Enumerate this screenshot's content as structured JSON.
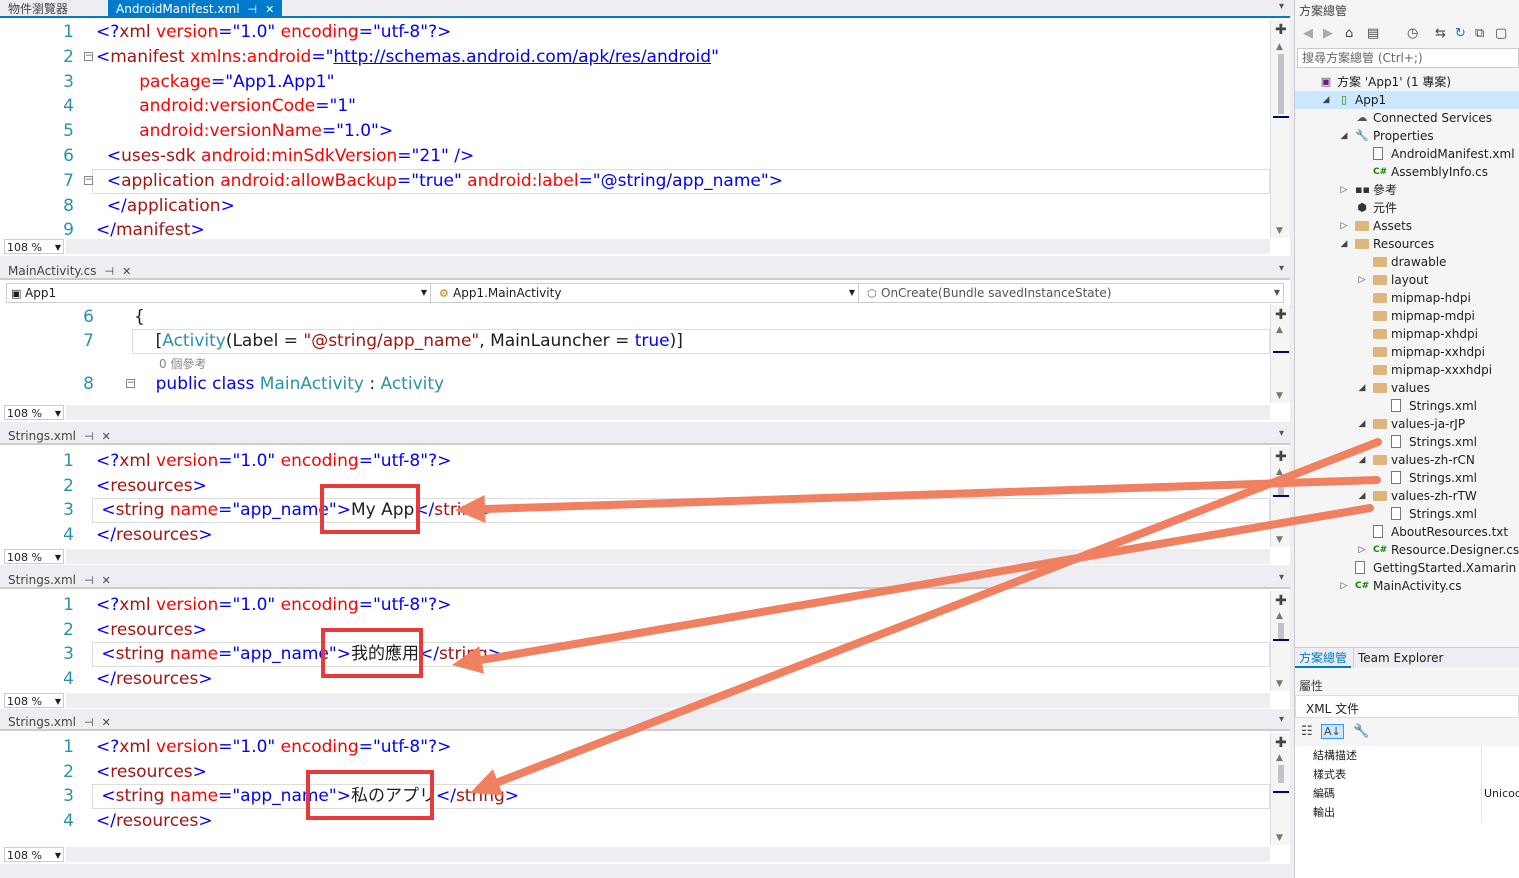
{
  "top_tabs": {
    "object_browser": "物件瀏覽器",
    "manifest": "AndroidManifest.xml"
  },
  "manifest_editor": {
    "zoom": "108 %",
    "lines": [
      {
        "n": "1",
        "parts": [
          [
            "b",
            "<?"
          ],
          [
            "r",
            "xml"
          ],
          [
            "rd",
            " version"
          ],
          [
            "b",
            "=\""
          ],
          [
            "b",
            "1.0"
          ],
          [
            "b",
            "\""
          ],
          [
            "rd",
            " encoding"
          ],
          [
            "b",
            "=\""
          ],
          [
            "b",
            "utf-8"
          ],
          [
            "b",
            "\"?>"
          ]
        ]
      },
      {
        "n": "2",
        "parts": [
          [
            "b",
            "<"
          ],
          [
            "r",
            "manifest"
          ],
          [
            "rd",
            " xmlns:android"
          ],
          [
            "b",
            "=\""
          ],
          [
            "u",
            "http://schemas.android.com/apk/res/android"
          ],
          [
            "b",
            "\""
          ]
        ]
      },
      {
        "n": "3",
        "parts": [
          [
            "",
            "        "
          ],
          [
            "rd",
            "package"
          ],
          [
            "b",
            "=\""
          ],
          [
            "b",
            "App1.App1"
          ],
          [
            "b",
            "\""
          ]
        ]
      },
      {
        "n": "4",
        "parts": [
          [
            "",
            "        "
          ],
          [
            "rd",
            "android:versionCode"
          ],
          [
            "b",
            "=\""
          ],
          [
            "b",
            "1"
          ],
          [
            "b",
            "\""
          ]
        ]
      },
      {
        "n": "5",
        "parts": [
          [
            "",
            "        "
          ],
          [
            "rd",
            "android:versionName"
          ],
          [
            "b",
            "=\""
          ],
          [
            "b",
            "1.0"
          ],
          [
            "b",
            "\">"
          ]
        ]
      },
      {
        "n": "6",
        "parts": [
          [
            "",
            "  "
          ],
          [
            "b",
            "<"
          ],
          [
            "r",
            "uses-sdk"
          ],
          [
            "rd",
            " android:minSdkVersion"
          ],
          [
            "b",
            "=\""
          ],
          [
            "b",
            "21"
          ],
          [
            "b",
            "\" />"
          ]
        ]
      },
      {
        "n": "7",
        "parts": [
          [
            "",
            "  "
          ],
          [
            "b",
            "<"
          ],
          [
            "r",
            "application"
          ],
          [
            "rd",
            " android:allowBackup"
          ],
          [
            "b",
            "=\""
          ],
          [
            "b",
            "true"
          ],
          [
            "b",
            "\""
          ],
          [
            "rd",
            " android:label"
          ],
          [
            "b",
            "=\""
          ],
          [
            "b",
            "@string/app_name"
          ],
          [
            "b",
            "\">"
          ]
        ]
      },
      {
        "n": "8",
        "parts": [
          [
            "",
            "  "
          ],
          [
            "b",
            "</"
          ],
          [
            "r",
            "application"
          ],
          [
            "b",
            ">"
          ]
        ]
      },
      {
        "n": "9",
        "parts": [
          [
            "b",
            "</"
          ],
          [
            "r",
            "manifest"
          ],
          [
            "b",
            ">"
          ]
        ]
      }
    ]
  },
  "mainactivity": {
    "tab": "MainActivity.cs",
    "nav": [
      "App1",
      "App1.MainActivity",
      "OnCreate(Bundle savedInstanceState)"
    ],
    "zoom": "108 %",
    "line6": "{",
    "line7_parts": [
      [
        "",
        "    ["
      ],
      [
        "t",
        "Activity"
      ],
      [
        "",
        "(Label = "
      ],
      [
        "r",
        "\"@string/app_name\""
      ],
      [
        "",
        ", MainLauncher = "
      ],
      [
        "k",
        "true"
      ],
      [
        "",
        ")]"
      ]
    ],
    "refs": "0 個參考",
    "line8_parts": [
      [
        "",
        "    "
      ],
      [
        "k",
        "public"
      ],
      [
        "k",
        " class"
      ],
      [
        "t",
        " MainActivity"
      ],
      [
        "",
        " : "
      ],
      [
        "t",
        "Activity"
      ]
    ],
    "ln6": "6",
    "ln7": "7",
    "ln8": "8"
  },
  "strings_editors": [
    {
      "tab": "Strings.xml",
      "zoom": "108 %",
      "value": "My App"
    },
    {
      "tab": "Strings.xml",
      "zoom": "108 %",
      "value": "我的應用"
    },
    {
      "tab": "Strings.xml",
      "zoom": "108 %",
      "value": "私のアプリ"
    }
  ],
  "solution_explorer": {
    "title": "方案總管",
    "search_placeholder": "搜尋方案總管 (Ctrl+;)",
    "items": [
      {
        "label": "方案 'App1' (1 專案)",
        "indent": 0,
        "icon": "solution-icon",
        "exp": ""
      },
      {
        "label": "App1",
        "indent": 1,
        "icon": "project-icon",
        "exp": "◢",
        "selected": true
      },
      {
        "label": "Connected Services",
        "indent": 2,
        "icon": "cloud-icon",
        "exp": ""
      },
      {
        "label": "Properties",
        "indent": 2,
        "icon": "wrench-icon",
        "exp": "◢"
      },
      {
        "label": "AndroidManifest.xml",
        "indent": 3,
        "icon": "file-icon",
        "exp": ""
      },
      {
        "label": "AssemblyInfo.cs",
        "indent": 3,
        "icon": "csharp-icon",
        "exp": ""
      },
      {
        "label": "參考",
        "indent": 2,
        "icon": "references-icon",
        "exp": "▷"
      },
      {
        "label": "元件",
        "indent": 2,
        "icon": "component-icon",
        "exp": ""
      },
      {
        "label": "Assets",
        "indent": 2,
        "icon": "folder-icon",
        "exp": "▷"
      },
      {
        "label": "Resources",
        "indent": 2,
        "icon": "folder-icon",
        "exp": "◢"
      },
      {
        "label": "drawable",
        "indent": 3,
        "icon": "folder-icon",
        "exp": ""
      },
      {
        "label": "layout",
        "indent": 3,
        "icon": "folder-icon",
        "exp": "▷"
      },
      {
        "label": "mipmap-hdpi",
        "indent": 3,
        "icon": "folder-icon",
        "exp": ""
      },
      {
        "label": "mipmap-mdpi",
        "indent": 3,
        "icon": "folder-icon",
        "exp": ""
      },
      {
        "label": "mipmap-xhdpi",
        "indent": 3,
        "icon": "folder-icon",
        "exp": ""
      },
      {
        "label": "mipmap-xxhdpi",
        "indent": 3,
        "icon": "folder-icon",
        "exp": ""
      },
      {
        "label": "mipmap-xxxhdpi",
        "indent": 3,
        "icon": "folder-icon",
        "exp": ""
      },
      {
        "label": "values",
        "indent": 3,
        "icon": "folder-icon",
        "exp": "◢"
      },
      {
        "label": "Strings.xml",
        "indent": 4,
        "icon": "file-icon",
        "exp": ""
      },
      {
        "label": "values-ja-rJP",
        "indent": 3,
        "icon": "folder-icon",
        "exp": "◢"
      },
      {
        "label": "Strings.xml",
        "indent": 4,
        "icon": "file-icon",
        "exp": ""
      },
      {
        "label": "values-zh-rCN",
        "indent": 3,
        "icon": "folder-icon",
        "exp": "◢"
      },
      {
        "label": "Strings.xml",
        "indent": 4,
        "icon": "file-icon",
        "exp": ""
      },
      {
        "label": "values-zh-rTW",
        "indent": 3,
        "icon": "folder-icon",
        "exp": "◢"
      },
      {
        "label": "Strings.xml",
        "indent": 4,
        "icon": "file-icon",
        "exp": ""
      },
      {
        "label": "AboutResources.txt",
        "indent": 3,
        "icon": "file-icon",
        "exp": ""
      },
      {
        "label": "Resource.Designer.cs",
        "indent": 3,
        "icon": "csharp-icon",
        "exp": "▷"
      },
      {
        "label": "GettingStarted.Xamarin",
        "indent": 2,
        "icon": "file-icon",
        "exp": ""
      },
      {
        "label": "MainActivity.cs",
        "indent": 2,
        "icon": "csharp-icon",
        "exp": "▷"
      }
    ],
    "tabs": [
      "方案總管",
      "Team Explorer"
    ]
  },
  "properties": {
    "title": "屬性",
    "object": "XML 文件",
    "rows": [
      {
        "name": "結構描述",
        "value": ""
      },
      {
        "name": "樣式表",
        "value": ""
      },
      {
        "name": "編碼",
        "value": "Unicode"
      },
      {
        "name": "輸出",
        "value": ""
      }
    ]
  },
  "colors": {
    "accent": "#007acc",
    "highlight": "#e83a3a",
    "arrow": "#f08060"
  }
}
